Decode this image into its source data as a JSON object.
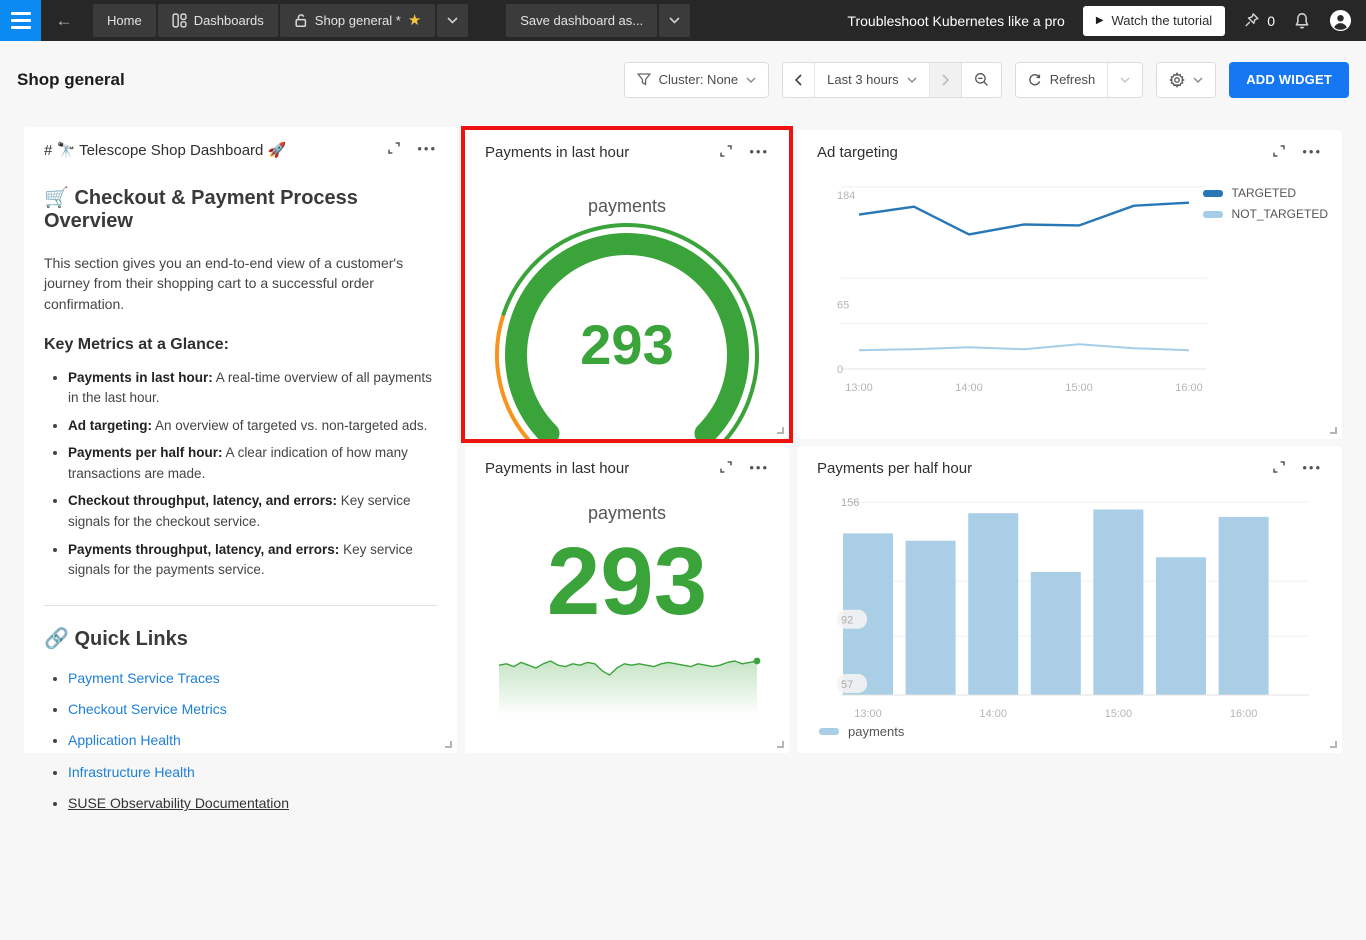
{
  "navbar": {
    "tabs": [
      "Home",
      "Dashboards",
      "Shop general *"
    ],
    "save_dashboard_label": "Save dashboard as...",
    "promo_text": "Troubleshoot Kubernetes like a pro",
    "tutorial_button_label": "Watch the tutorial",
    "pin_count": "0"
  },
  "toolbar": {
    "page_title": "Shop general",
    "cluster_filter_label": "Cluster: None",
    "time_range_label": "Last 3 hours",
    "refresh_label": "Refresh",
    "add_widget_label": "ADD WIDGET"
  },
  "markdown_widget": {
    "title": "# 🔭 Telescope Shop Dashboard 🚀",
    "heading": "🛒 Checkout & Payment Process Overview",
    "intro": "This section gives you an end-to-end view of a customer's journey from their shopping cart to a successful order confirmation.",
    "metrics_heading": "Key Metrics at a Glance:",
    "metrics": [
      {
        "lead": "Payments in last hour:",
        "text": " A real-time overview of all payments in the last hour."
      },
      {
        "lead": "Ad targeting:",
        "text": " An overview of targeted vs. non-targeted ads."
      },
      {
        "lead": "Payments per half hour:",
        "text": " A clear indication of how many transactions are made."
      },
      {
        "lead": "Checkout throughput, latency, and errors:",
        "text": " Key service signals for the checkout service."
      },
      {
        "lead": "Payments throughput, latency, and errors:",
        "text": " Key service signals for the payments service."
      }
    ],
    "links_heading": "🔗 Quick Links",
    "links": [
      "Payment Service Traces",
      "Checkout Service Metrics",
      "Application Health",
      "Infrastructure Health",
      "SUSE Observability Documentation"
    ]
  },
  "gauge_widget": {
    "title": "Payments in last hour",
    "metric": "payments",
    "value": "293"
  },
  "number_widget": {
    "title": "Payments in last hour",
    "metric": "payments",
    "value": "293"
  },
  "ad_widget": {
    "title": "Ad targeting"
  },
  "bar_widget": {
    "title": "Payments per half hour"
  },
  "colors": {
    "green": "#3aa33a",
    "orange": "#f7941e",
    "line_dark_blue": "#2878b8",
    "line_light_blue": "#a5cde8",
    "bar_blue": "#a9cee5",
    "accent_blue": "#1578f2",
    "highlight_red": "#ee1310"
  },
  "chart_data": [
    {
      "id": "ad_targeting",
      "type": "line",
      "title": "Ad targeting",
      "x": [
        "13:00",
        "13:30",
        "14:00",
        "14:30",
        "15:00",
        "15:30",
        "16:00"
      ],
      "x_ticks": [
        "13:00",
        "14:00",
        "15:00",
        "16:00"
      ],
      "series": [
        {
          "name": "NOT_TARGETED",
          "color": "#a5cde8",
          "values": [
            19,
            20,
            22,
            20,
            25,
            21,
            19
          ]
        },
        {
          "name": "TARGETED",
          "color": "#2878b8",
          "values": [
            156,
            164,
            136,
            146,
            145,
            165,
            168
          ]
        }
      ],
      "ylim": [
        0,
        196
      ],
      "y_labels": [
        {
          "v": 184,
          "t": "184"
        },
        {
          "v": 65,
          "t": "65"
        },
        {
          "v": 0,
          "t": "0"
        }
      ],
      "gridlines": [
        184,
        92,
        46,
        0
      ],
      "legend_position": "right"
    },
    {
      "id": "payments_per_half_hour",
      "type": "bar",
      "title": "Payments per half hour",
      "x": [
        "13:00",
        "13:30",
        "14:00",
        "14:30",
        "15:00",
        "15:30",
        "16:00"
      ],
      "x_ticks": [
        "13:00",
        "14:00",
        "15:00",
        "16:00"
      ],
      "series": [
        {
          "name": "payments",
          "color": "#a9cee5",
          "values": [
            139,
            135,
            150,
            118,
            152,
            126,
            148
          ]
        }
      ],
      "ylim": [
        51,
        161
      ],
      "y_labels": [
        {
          "v": 156,
          "t": "156",
          "pill": false
        },
        {
          "v": 92,
          "t": "92",
          "pill": true
        },
        {
          "v": 57,
          "t": "57",
          "pill": true
        }
      ],
      "gridlines": [
        156,
        113,
        83
      ],
      "legend_position": "bottom"
    },
    {
      "id": "payments_gauge",
      "type": "gauge",
      "title": "Payments in last hour",
      "metric": "payments",
      "value": 293,
      "scale_colors": [
        {
          "color": "#f7941e",
          "until": 0.235
        },
        {
          "color": "#3aa33a",
          "until": 1
        }
      ],
      "progress_color": "#3aa33a",
      "progress_fraction": 1
    },
    {
      "id": "payments_sparkline",
      "type": "area",
      "color": "#3aa33a",
      "values": [
        290,
        291,
        289,
        292,
        290,
        288,
        291,
        293,
        290,
        289,
        291,
        290,
        292,
        291,
        286,
        283,
        288,
        291,
        290,
        291,
        290,
        289,
        291,
        292,
        291,
        290,
        289,
        291,
        290,
        289,
        290,
        292,
        293,
        291,
        292,
        293
      ]
    }
  ]
}
